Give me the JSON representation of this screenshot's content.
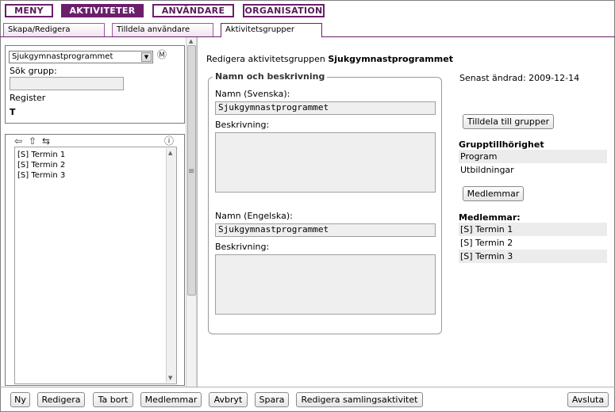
{
  "menu": {
    "items": [
      {
        "label": "MENY"
      },
      {
        "label": "AKTIVITETER"
      },
      {
        "label": "ANVÄNDARE"
      },
      {
        "label": "ORGANISATION"
      }
    ]
  },
  "tabs": [
    {
      "label": "Skapa/Redigera"
    },
    {
      "label": "Tilldela användare"
    },
    {
      "label": "Aktivitetsgrupper"
    }
  ],
  "left": {
    "group_select": "Sjukgymnastprogrammet",
    "search_label": "Sök grupp:",
    "search_value": "",
    "register_label": "Register",
    "register_letter": "T",
    "list_items": [
      "[S] Termin 1",
      "[S] Termin 2",
      "[S] Termin 3"
    ]
  },
  "editor": {
    "heading_prefix": "Redigera aktivitetsgruppen",
    "heading_name": "Sjukgymnastprogrammet",
    "legend": "Namn och beskrivning",
    "name_sv_label": "Namn (Svenska):",
    "name_sv_value": "Sjukgymnastprogrammet",
    "desc_sv_label": "Beskrivning:",
    "name_en_label": "Namn (Engelska):",
    "name_en_value": "Sjukgymnastprogrammet",
    "desc_en_label": "Beskrivning:"
  },
  "right": {
    "last_changed_label": "Senast ändrad:",
    "last_changed_date": "2009-12-14",
    "assign_button": "Tilldela till grupper",
    "membership_title": "Grupptillhörighet",
    "membership_items": [
      "Program",
      "Utbildningar"
    ],
    "members_button": "Medlemmar",
    "members_title": "Medlemmar:",
    "members_items": [
      "[S] Termin 1",
      "[S] Termin 2",
      "[S] Termin 3"
    ]
  },
  "bottom": {
    "new": "Ny",
    "edit": "Redigera",
    "delete": "Ta bort",
    "members": "Medlemmar",
    "cancel": "Avbryt",
    "save": "Spara",
    "edit_collection": "Redigera samlingsaktivitet",
    "exit": "Avsluta"
  },
  "colors": {
    "accent": "#6b1f6b"
  },
  "icons": [
    "back-arrow-icon",
    "up-arrow-icon",
    "split-arrow-icon",
    "info-icon",
    "m-circle-icon"
  ]
}
